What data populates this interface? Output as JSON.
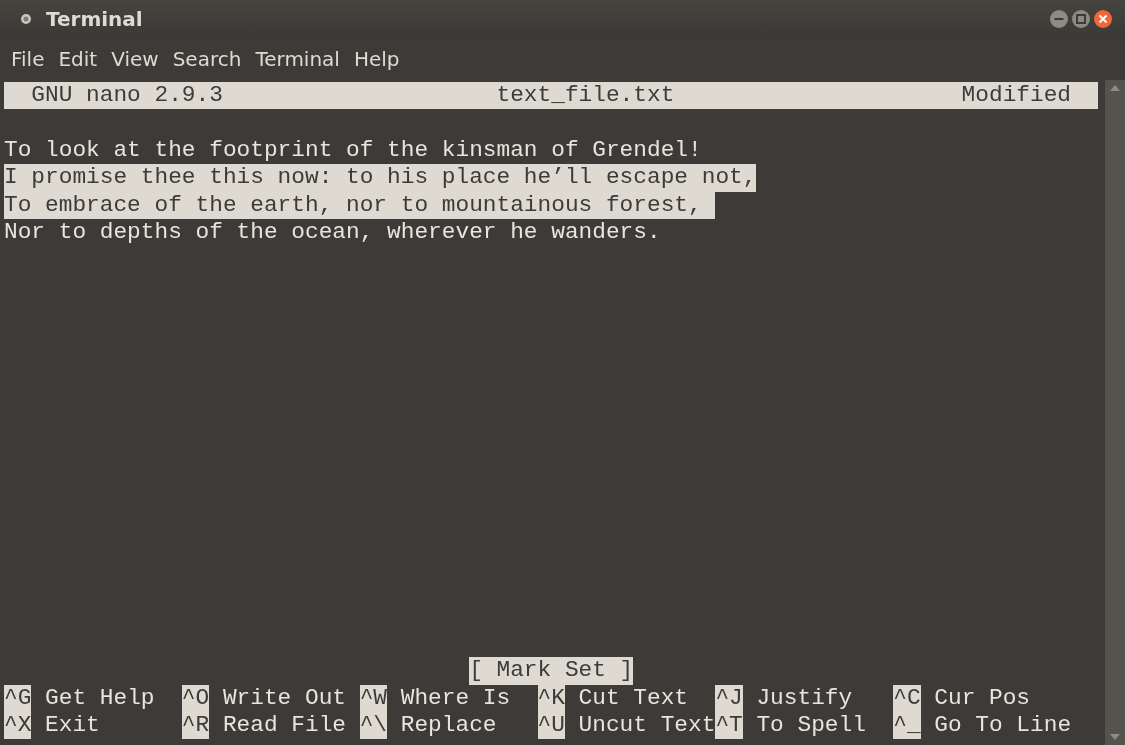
{
  "window": {
    "title": "Terminal"
  },
  "menu": [
    "File",
    "Edit",
    "View",
    "Search",
    "Terminal",
    "Help"
  ],
  "nano": {
    "version": "GNU nano 2.9.3",
    "filename": "text_file.txt",
    "status": "Modified"
  },
  "lines": [
    {
      "text": "To look at the footprint of the kinsman of Grendel!",
      "selected": false,
      "cursor": false
    },
    {
      "text": "I promise thee this now: to his place he’ll escape not,",
      "selected": true,
      "cursor": false
    },
    {
      "text": "To embrace of the earth, nor to mountainous forest,",
      "selected": true,
      "cursor": true
    },
    {
      "text": "Nor to depths of the ocean, wherever he wanders.",
      "selected": false,
      "cursor": false
    }
  ],
  "message": "[ Mark Set ]",
  "shortcut_rows": [
    [
      {
        "key": "^G",
        "label": "Get Help"
      },
      {
        "key": "^O",
        "label": "Write Out"
      },
      {
        "key": "^W",
        "label": "Where Is"
      },
      {
        "key": "^K",
        "label": "Cut Text"
      },
      {
        "key": "^J",
        "label": "Justify"
      },
      {
        "key": "^C",
        "label": "Cur Pos"
      }
    ],
    [
      {
        "key": "^X",
        "label": "Exit"
      },
      {
        "key": "^R",
        "label": "Read File"
      },
      {
        "key": "^\\",
        "label": "Replace"
      },
      {
        "key": "^U",
        "label": "Uncut Text"
      },
      {
        "key": "^T",
        "label": "To Spell"
      },
      {
        "key": "^_",
        "label": "Go To Line"
      }
    ]
  ]
}
